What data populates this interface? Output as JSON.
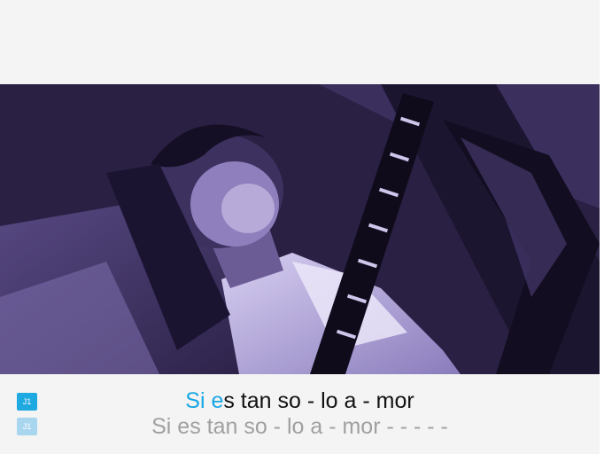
{
  "colors": {
    "background": "#f4f4f4",
    "sung_highlight": "#19a7e4",
    "current_line_text": "#111111",
    "next_line_text": "#a0a0a0",
    "player1_badge": "#1fa9e1",
    "player1_badge_inactive": "#a9d6ef",
    "video_tint": "#2a2043"
  },
  "video": {
    "scene_icon": "guitarist-silhouette"
  },
  "lyrics": {
    "current": {
      "player_badge": "J1",
      "sung": "Si e",
      "unsung": "s tan so - lo a - mor"
    },
    "next": {
      "player_badge": "J1",
      "text": "Si es tan so - lo a - mor - - - - -"
    }
  }
}
